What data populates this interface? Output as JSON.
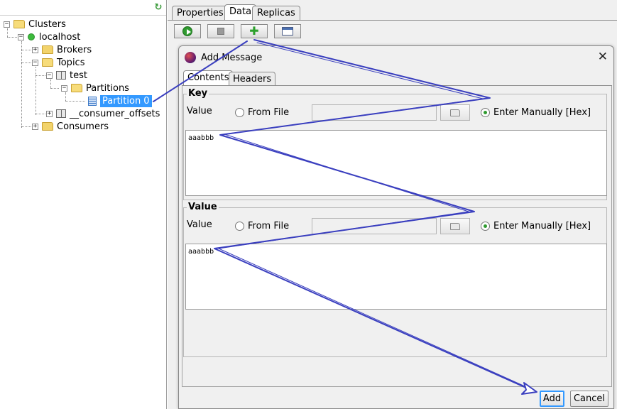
{
  "tree": {
    "root": {
      "label": "Clusters",
      "icon": "folder-open-icon"
    },
    "cluster": {
      "label": "localhost",
      "icon": "status-green-icon"
    },
    "brokers": {
      "label": "Brokers"
    },
    "topics": {
      "label": "Topics"
    },
    "topic_test": {
      "label": "test"
    },
    "partitions": {
      "label": "Partitions"
    },
    "partition0": {
      "label": "Partition 0"
    },
    "consumer_offsets": {
      "label": "__consumer_offsets"
    },
    "consumers": {
      "label": "Consumers"
    }
  },
  "tabs": [
    {
      "label": "Properties"
    },
    {
      "label": "Data"
    },
    {
      "label": "Replicas"
    }
  ],
  "toolbar": {
    "buttons": [
      "play-icon",
      "stop-icon",
      "add-icon",
      "window-icon"
    ]
  },
  "dialog": {
    "title": "Add Message",
    "tabs": [
      {
        "label": "Contents"
      },
      {
        "label": "Headers"
      }
    ],
    "key": {
      "group_title": "Key",
      "value_label": "Value",
      "from_file": "From File",
      "enter_manually": "Enter Manually [Hex]",
      "text": "aaabbb"
    },
    "value": {
      "group_title": "Value",
      "value_label": "Value",
      "from_file": "From File",
      "enter_manually": "Enter Manually [Hex]",
      "text": "aaabbb"
    },
    "add_label": "Add",
    "cancel_label": "Cancel"
  },
  "colors": {
    "selection": "#3399ff",
    "annotation_arrow": "#3a3fbf",
    "status_green": "#3dbb3d"
  }
}
